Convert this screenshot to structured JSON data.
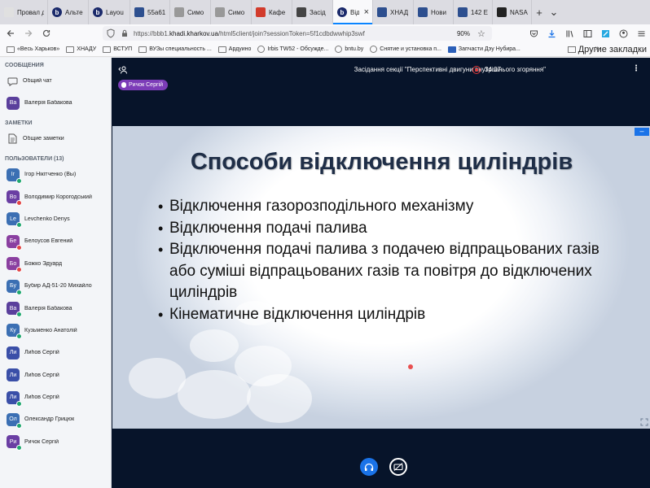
{
  "browser": {
    "tabs": [
      {
        "label": "Провал д",
        "icon": "page-icon",
        "color": "#e0e0e0"
      },
      {
        "label": "Альте",
        "icon": "bbb-icon",
        "color": "#1b2a6b"
      },
      {
        "label": "Layou",
        "icon": "bbb-icon",
        "color": "#1b2a6b"
      },
      {
        "label": "55а61",
        "icon": "bird-icon",
        "color": "#2d4f8f"
      },
      {
        "label": "Симо",
        "icon": "page-icon",
        "color": "#999999"
      },
      {
        "label": "Симо",
        "icon": "page-icon",
        "color": "#999999"
      },
      {
        "label": "Кафе",
        "icon": "red-icon",
        "color": "#d23b2b"
      },
      {
        "label": "Засід",
        "icon": "doc-icon",
        "color": "#444444"
      },
      {
        "label": "Від",
        "sublabel": "вос",
        "icon": "bbb-icon",
        "color": "#1b2a6b",
        "active": true
      },
      {
        "label": "ХНАД",
        "icon": "bird-icon",
        "color": "#2d4f8f"
      },
      {
        "label": "Нови",
        "icon": "bird-icon",
        "color": "#2d4f8f"
      },
      {
        "label": "142 Е",
        "icon": "bird-icon",
        "color": "#2d4f8f"
      },
      {
        "label": "NASA",
        "icon": "github-icon",
        "color": "#222222"
      }
    ],
    "url_prefix": "https://bbb1.",
    "url_host": "khadi.kharkov.ua",
    "url_path": "/html5client/join?sessionToken=5f1cdbdwwhip3swf",
    "zoom": "90%",
    "bookmarks": [
      {
        "label": "«Весь Харьков»",
        "icon": "folder"
      },
      {
        "label": "ХНАДУ",
        "icon": "folder"
      },
      {
        "label": "ВСТУП",
        "icon": "folder"
      },
      {
        "label": "ВУЗы специальность ...",
        "icon": "folder"
      },
      {
        "label": "Ардуино",
        "icon": "folder"
      },
      {
        "label": "Irbis TW52 - Обсужде...",
        "icon": "globe"
      },
      {
        "label": "bntu.by",
        "icon": "globe"
      },
      {
        "label": "Снятие и установка п...",
        "icon": "globe"
      },
      {
        "label": "Запчасти Дэу Нубира...",
        "icon": "z"
      }
    ],
    "bookmarks_more": "»",
    "bookmarks_other": "Другие закладки"
  },
  "sidebar": {
    "messages_title": "СООБЩЕНИЯ",
    "public_chat": "Общий чат",
    "chat_user": {
      "initials": "Ва",
      "name": "Валерія Бабакова",
      "color": "#5a3f9c"
    },
    "notes_title": "ЗАМЕТКИ",
    "shared_notes": "Общие заметки",
    "users_title": "ПОЛЬЗОВАТЕЛИ (13)",
    "users": [
      {
        "initials": "Іг",
        "name": "Ігор Нікітченко (Вы)",
        "color": "#3b6fb3",
        "mic": "#1fa76f"
      },
      {
        "initials": "Во",
        "name": "Володимир Корогодський",
        "color": "#6a3ea3",
        "mic": "#e24545"
      },
      {
        "initials": "Le",
        "name": "Levchenko Denys",
        "color": "#3b6fb3",
        "mic": "#1fa76f"
      },
      {
        "initials": "Бе",
        "name": "Белоусов Евгений",
        "color": "#8a3fa0",
        "mic": "#e24545"
      },
      {
        "initials": "Бо",
        "name": "Божко Эдуард",
        "color": "#8a3fa0",
        "mic": "#e24545"
      },
      {
        "initials": "Бу",
        "name": "Бубир АД-51-20 Михайло",
        "color": "#3b6fb3",
        "mic": "#1fa76f"
      },
      {
        "initials": "Ва",
        "name": "Валерія Бабакова",
        "color": "#5a3f9c",
        "mic": "#1fa76f"
      },
      {
        "initials": "Ку",
        "name": "Кузьменко Анатолій",
        "color": "#3b6fb3",
        "mic": "#1fa76f"
      },
      {
        "initials": "Ли",
        "name": "Лиhов Сергій",
        "color": "#3a4fa8",
        "mic": ""
      },
      {
        "initials": "Ли",
        "name": "Лиhов Сергій",
        "color": "#3a4fa8",
        "mic": ""
      },
      {
        "initials": "Ли",
        "name": "Лиhов Сергій",
        "color": "#3a4fa8",
        "mic": "#1fa76f"
      },
      {
        "initials": "Ол",
        "name": "Олександр Грицюк",
        "color": "#3b6fb3",
        "mic": "#1fa76f"
      },
      {
        "initials": "Ри",
        "name": "Ричок Сергій",
        "color": "#6a3ea3",
        "mic": "#1fa76f"
      }
    ]
  },
  "meeting": {
    "title": "Засідання секції \"Перспективні двигуни внутрішнього згоряння\"",
    "recording_time": "34:07",
    "talker": "Ричок Сергій",
    "slide": {
      "title": "Способи відключення циліндрів",
      "bullets": [
        "Відключення газорозподільного механізму",
        "Відключення подачі палива",
        "Відключення подачі палива з подачею відпрацьованих газів або суміші відпрацьованих газів та повітря до відключених циліндрів",
        "Кінематичне відключення циліндрів"
      ],
      "minimize_label": "–"
    }
  }
}
